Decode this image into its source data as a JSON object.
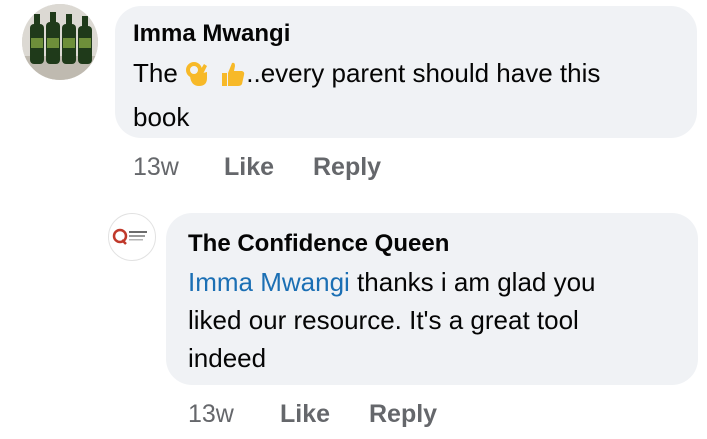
{
  "comments": [
    {
      "author": "Imma Mwangi",
      "text_start": "The ",
      "emoji_1": "ok-hand-emoji",
      "emoji_2": "thumbs-up-emoji",
      "text_line1_rest": "..every parent should have this",
      "text_line2": "book",
      "time": "13w",
      "like_label": "Like",
      "reply_label": "Reply"
    },
    {
      "author": "The Confidence Queen",
      "avatar_text": "The Confidence Queen",
      "mention": "Imma Mwangi",
      "text_line1_rest": " thanks i am glad you",
      "text_line2": "liked our resource. It's a great tool",
      "text_line3": "indeed",
      "time": "13w",
      "like_label": "Like",
      "reply_label": "Reply"
    }
  ],
  "colors": {
    "bubble": "#f0f2f5",
    "mention": "#1b6fb4",
    "meta": "#65676b",
    "emoji": "#f7b928"
  }
}
